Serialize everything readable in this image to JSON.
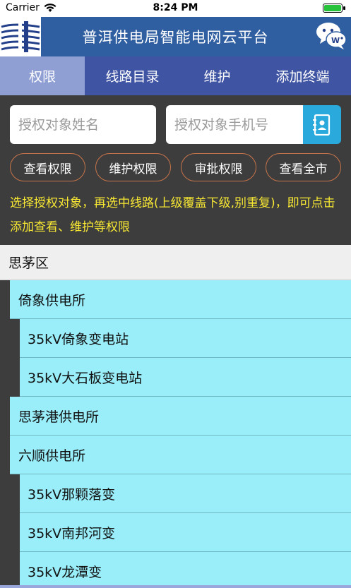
{
  "status_bar": {
    "carrier": "Carrier",
    "time": "8:24 PM"
  },
  "header": {
    "title": "普洱供电局智能电网云平台",
    "logo_icon": "utility-logo-icon",
    "chat_icon": "wechat-icon"
  },
  "tabs": [
    {
      "label": "权限",
      "active": true
    },
    {
      "label": "线路目录",
      "active": false
    },
    {
      "label": "维护",
      "active": false
    },
    {
      "label": "添加终端",
      "active": false
    }
  ],
  "search": {
    "name_placeholder": "授权对象姓名",
    "name_value": "",
    "phone_placeholder": "授权对象手机号",
    "phone_value": "",
    "contacts_icon": "contacts-book-icon"
  },
  "actions": {
    "view_permission": "查看权限",
    "maintain_permission": "维护权限",
    "approve_permission": "审批权限",
    "view_city": "查看全市"
  },
  "hint": "选择授权对象，再选中线路(上级覆盖下级,别重复)，即可点击添加查看、维护等权限",
  "tree": {
    "district": "思茅区",
    "items": [
      {
        "label": "倚象供电所",
        "level": 1
      },
      {
        "label": "35kV倚象变电站",
        "level": 2
      },
      {
        "label": "35kV大石板变电站",
        "level": 2
      },
      {
        "label": "思茅港供电所",
        "level": 1
      },
      {
        "label": "六顺供电所",
        "level": 1
      },
      {
        "label": "35kV那颗落变",
        "level": 2
      },
      {
        "label": "35kV南邦河变",
        "level": 2
      },
      {
        "label": "35kV龙潭变",
        "level": 2
      }
    ]
  },
  "colors": {
    "header_bg": "#2f5ea1",
    "tabs_bg": "#3f54a3",
    "tab_active_bg": "#8f9fd4",
    "panel_bg": "#3d3d3d",
    "hint_text": "#f7e733",
    "pill_border": "#c8744a",
    "node_bg": "#99eefa",
    "contacts_button_bg": "#2aa9dc"
  }
}
